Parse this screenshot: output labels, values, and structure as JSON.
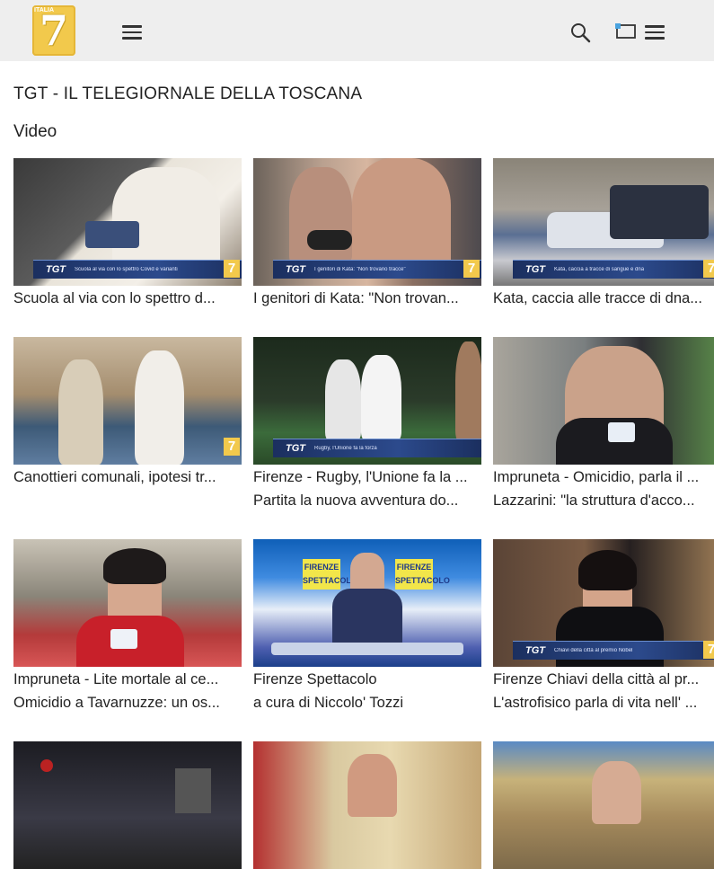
{
  "header": {
    "logo_small_text": "ITALIA",
    "logo_number": "7"
  },
  "page": {
    "title": "TGT - IL TELEGIORNALE DELLA TOSCANA",
    "section": "Video"
  },
  "videos": [
    {
      "title": "Scuola al via con lo spettro d...",
      "subtitle": "",
      "overlay": "TGT",
      "overlay_text": "Scuola al via con lo spettro Covid e varianti"
    },
    {
      "title": "I genitori di Kata: \"Non trovan...",
      "subtitle": "",
      "overlay": "TGT",
      "overlay_text": "I genitori di Kata: \"Non trovano tracce\""
    },
    {
      "title": "Kata, caccia alle tracce di dna...",
      "subtitle": "",
      "overlay": "TGT",
      "overlay_text": "Kata, caccia a tracce di sangue e dna"
    },
    {
      "title": "Canottieri comunali, ipotesi tr...",
      "subtitle": "",
      "overlay": "",
      "overlay_text": ""
    },
    {
      "title": "Firenze - Rugby, l'Unione fa la ...",
      "subtitle": "Partita la nuova avventura do...",
      "overlay": "TGT",
      "overlay_text": "Rugby, l'Unione fa la forza"
    },
    {
      "title": "Impruneta - Omicidio, parla il ...",
      "subtitle": "Lazzarini: \"la struttura d'acco...",
      "overlay": "",
      "overlay_text": ""
    },
    {
      "title": "Impruneta - Lite mortale al ce...",
      "subtitle": "Omicidio a Tavarnuzze: un os...",
      "overlay": "",
      "overlay_text": ""
    },
    {
      "title": "Firenze Spettacolo",
      "subtitle": "a cura di Niccolo' Tozzi",
      "overlay": "",
      "overlay_text": "",
      "sign_left": "FIRENZE SPETTACOLO",
      "sign_right": "FIRENZE SPETTACOLO"
    },
    {
      "title": "Firenze Chiavi della città al pr...",
      "subtitle": "L'astrofisico parla di vita nell' ...",
      "overlay": "TGT",
      "overlay_text": "Chiavi della città al premio Nobel"
    },
    {
      "title": "",
      "subtitle": "",
      "overlay": "",
      "overlay_text": ""
    },
    {
      "title": "",
      "subtitle": "",
      "overlay": "",
      "overlay_text": ""
    },
    {
      "title": "",
      "subtitle": "",
      "overlay": "",
      "overlay_text": ""
    }
  ]
}
